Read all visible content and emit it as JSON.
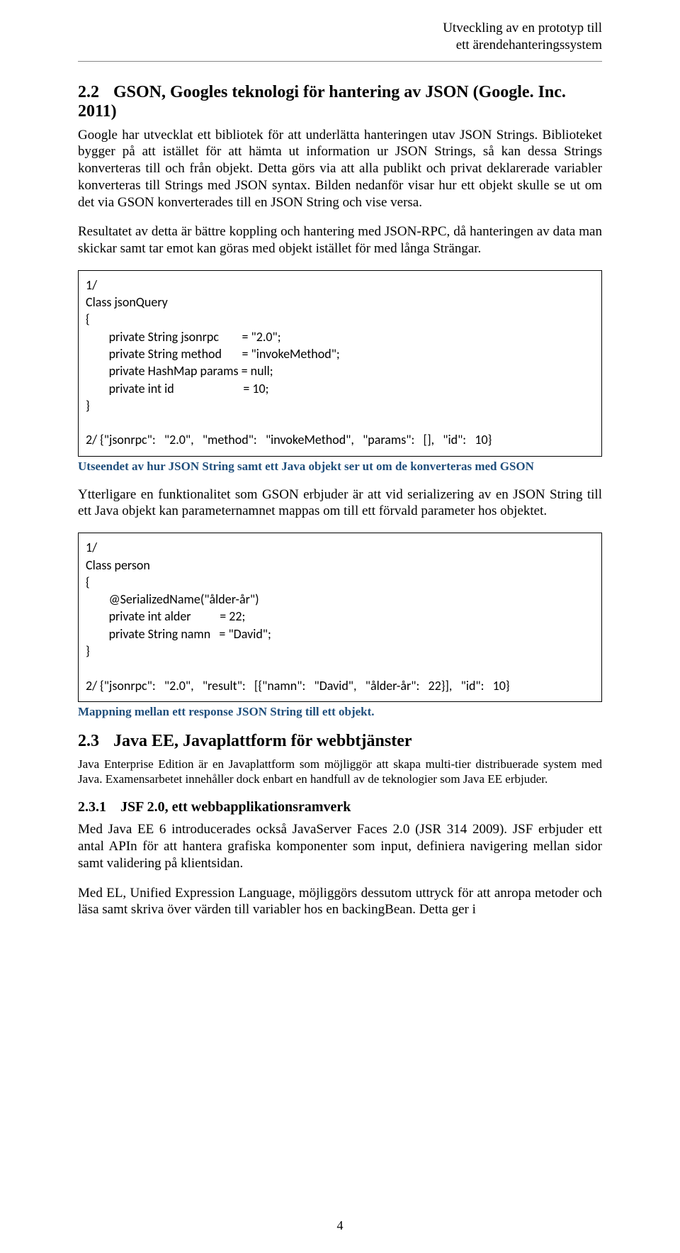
{
  "header": {
    "line1": "Utveckling av en prototyp till",
    "line2": "ett ärendehanteringssystem"
  },
  "section_2_2": {
    "number": "2.2",
    "title": "GSON, Googles teknologi för hantering av JSON (Google. Inc. 2011)",
    "p1": "Google har utvecklat ett bibliotek för att underlätta hanteringen utav JSON Strings. Biblioteket bygger på att istället för att hämta ut information ur JSON Strings, så kan dessa Strings konverteras till och från objekt. Detta görs via att alla publikt och privat deklarerade variabler konverteras till Strings med JSON syntax. Bilden nedanför visar hur ett objekt skulle se ut om det via GSON konverterades till en JSON String och vise versa.",
    "p2": "Resultatet av detta är bättre koppling och hantering med JSON-RPC, då hanteringen av data man skickar samt tar emot kan göras med objekt istället för med långa Strängar.",
    "code1": "1/\nClass jsonQuery\n{\n        private String jsonrpc        = \"2.0\";\n        private String method       = \"invokeMethod\";\n        private HashMap params = null;\n        private int id                        = 10;\n}\n\n2/ {\"jsonrpc\":   \"2.0\",   \"method\":   \"invokeMethod\",   \"params\":   [],   \"id\":   10}",
    "caption1": "Utseendet av hur JSON String samt ett Java objekt ser ut om de konverteras med GSON",
    "p3": "Ytterligare en funktionalitet som GSON erbjuder är att vid serializering av en JSON String till ett Java objekt kan parameternamnet mappas om till ett förvald parameter hos objektet.",
    "code2": "1/\nClass person\n{\n        @SerializedName(\"ålder-år\")\n        private int alder          = 22;\n        private String namn   = \"David\";\n}\n\n2/ {\"jsonrpc\":   \"2.0\",   \"result\":   [{\"namn\":   \"David\",   \"ålder-år\":   22}],   \"id\":   10}",
    "caption2": "Mappning mellan ett response JSON String till ett objekt."
  },
  "section_2_3": {
    "number": "2.3",
    "title": "Java EE, Javaplattform för webbtjänster",
    "intro": "Java Enterprise Edition är en Javaplattform som möjliggör att skapa multi-tier distribuerade system med Java. Examensarbetet innehåller dock enbart en handfull av de teknologier som Java EE erbjuder.",
    "sub1": {
      "number": "2.3.1",
      "title": "JSF 2.0, ett webbapplikationsramverk",
      "p1": "Med Java EE 6 introducerades också JavaServer Faces 2.0 (JSR 314 2009). JSF erbjuder ett antal APIn för att hantera grafiska komponenter som input, definiera navigering mellan sidor samt validering på klientsidan.",
      "p2": "Med EL, Unified Expression Language, möjliggörs dessutom uttryck för att anropa metoder och läsa samt skriva över värden till variabler hos en backingBean. Detta ger i"
    }
  },
  "page_number": "4"
}
